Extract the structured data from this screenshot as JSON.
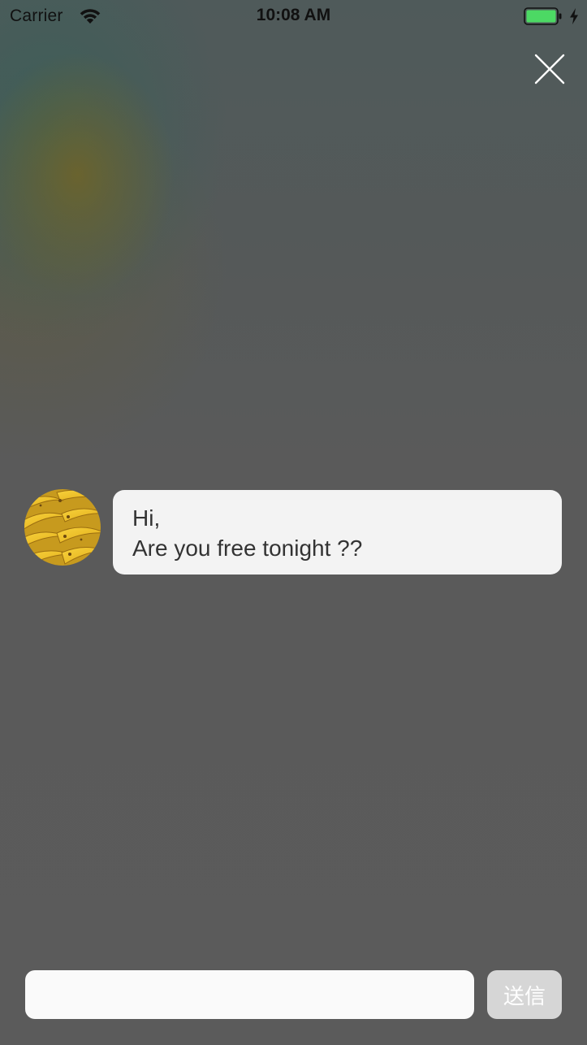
{
  "status_bar": {
    "carrier": "Carrier",
    "time": "10:08 AM",
    "battery_fill": 1.0,
    "battery_color": "#4cd964",
    "charging": true
  },
  "header": {
    "close_icon": "close-icon"
  },
  "message": {
    "avatar_icon": "banana-avatar",
    "line1": "Hi,",
    "line2": "Are you free tonight ??"
  },
  "composer": {
    "input_value": "",
    "input_placeholder": "",
    "send_label": "送信"
  }
}
